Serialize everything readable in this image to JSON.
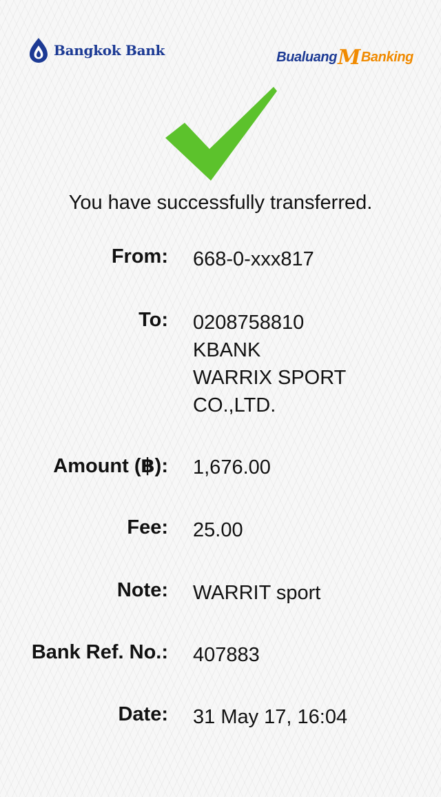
{
  "header": {
    "bank_name": "Bangkok Bank",
    "app_name_part1": "Bualuang",
    "app_name_mark": "M",
    "app_name_part2": "Banking",
    "brand_blue": "#1c3a94",
    "brand_orange": "#f08a00"
  },
  "status": {
    "icon": "checkmark-icon",
    "icon_color": "#5cc22c",
    "message": "You have successfully transferred."
  },
  "details": {
    "from": {
      "label": "From:",
      "value": "668-0-xxx817"
    },
    "to": {
      "label": "To:",
      "account": "0208758810",
      "bank": "KBANK",
      "name_line1": "WARRIX SPORT",
      "name_line2": "CO.,LTD."
    },
    "amount": {
      "label": "Amount (฿):",
      "value": "1,676.00"
    },
    "fee": {
      "label": "Fee:",
      "value": "25.00"
    },
    "note": {
      "label": "Note:",
      "value": "WARRIT sport"
    },
    "ref": {
      "label": "Bank Ref. No.:",
      "value": "407883"
    },
    "date": {
      "label": "Date:",
      "value": "31 May 17, 16:04"
    }
  }
}
